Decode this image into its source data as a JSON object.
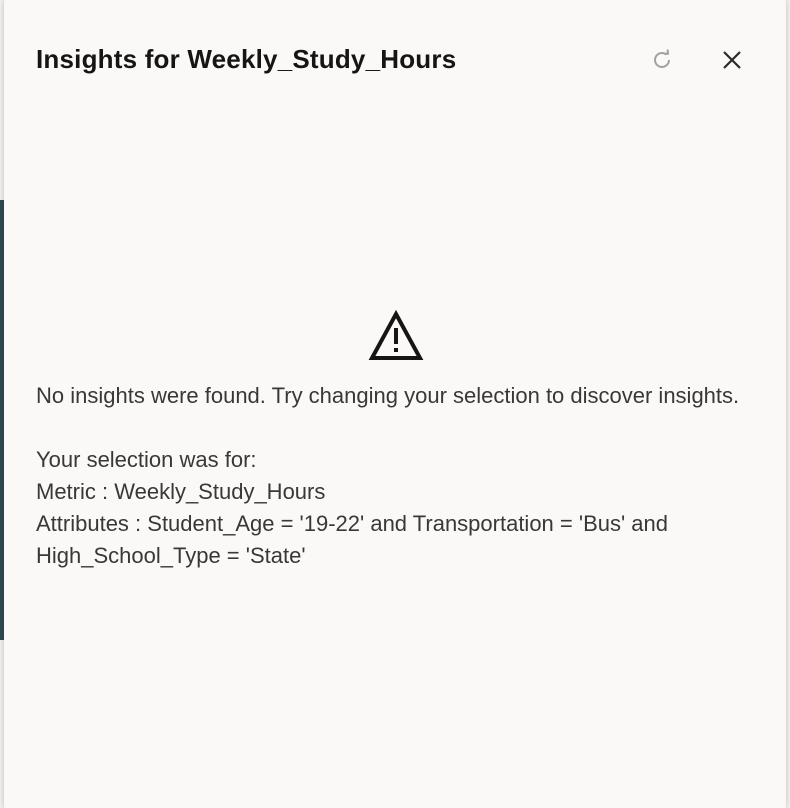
{
  "dialog": {
    "title": "Insights for Weekly_Study_Hours",
    "refresh_icon": "refresh-icon",
    "close_icon": "close-icon"
  },
  "empty_state": {
    "icon": "warning-icon",
    "message": "No insights were found. Try changing your selection to discover insights.",
    "selection_heading": "Your selection was for:",
    "metric_line": "Metric : Weekly_Study_Hours",
    "attributes_line": "Attributes : Student_Age = '19-22' and Transportation = 'Bus' and High_School_Type = 'State'"
  },
  "colors": {
    "panel_bg": "#fbf9f8",
    "title_text": "#161513",
    "body_text": "#3a3836",
    "icon_muted": "#9a9793"
  }
}
